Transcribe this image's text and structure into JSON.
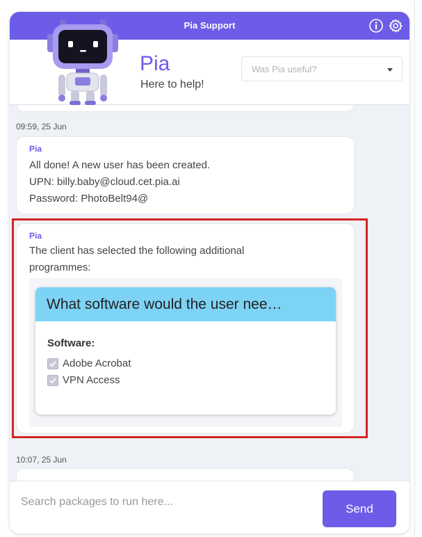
{
  "header": {
    "title": "Pia Support",
    "icons": [
      "info-icon",
      "gear-icon"
    ]
  },
  "profile": {
    "name": "Pia",
    "tagline": "Here to help!",
    "feedback_placeholder": "Was Pia useful?"
  },
  "messages": [
    {
      "timestamp": "09:59, 25 Jun",
      "sender": "Pia",
      "lines": [
        "All done! A new user has been created.",
        "UPN: billy.baby@cloud.cet.pia.ai",
        "Password: PhotoBelt94@"
      ]
    },
    {
      "sender": "Pia",
      "lines": [
        "The client has selected the following additional",
        "programmes:"
      ],
      "card": {
        "question": "What software would the user nee…",
        "label": "Software:",
        "options": [
          {
            "label": "Adobe Acrobat",
            "checked": true
          },
          {
            "label": "VPN Access",
            "checked": true
          }
        ]
      }
    },
    {
      "timestamp": "10:07, 25 Jun"
    }
  ],
  "composer": {
    "placeholder": "Search packages to run here...",
    "send_label": "Send"
  },
  "colors": {
    "accent": "#6c5ce7",
    "card_header": "#7dd3f5",
    "highlight": "#d42525"
  }
}
